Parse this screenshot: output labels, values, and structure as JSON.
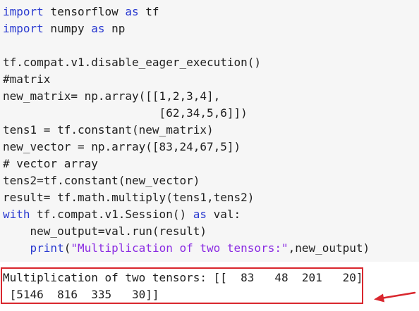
{
  "code_cell": {
    "lines": [
      [
        {
          "t": "import",
          "k": "kw"
        },
        {
          "t": " tensorflow "
        },
        {
          "t": "as",
          "k": "kw"
        },
        {
          "t": " tf"
        }
      ],
      [
        {
          "t": "import",
          "k": "kw"
        },
        {
          "t": " numpy "
        },
        {
          "t": "as",
          "k": "kw"
        },
        {
          "t": " np"
        }
      ],
      [],
      [
        {
          "t": "tf.compat.v1.disable_eager_execution()"
        }
      ],
      [
        {
          "t": "#matrix"
        }
      ],
      [
        {
          "t": "new_matrix= np.array([[1,2,3,4],"
        }
      ],
      [
        {
          "t": "                       [62,34,5,6]])"
        }
      ],
      [
        {
          "t": "tens1 = tf.constant(new_matrix)"
        }
      ],
      [
        {
          "t": "new_vector = np.array([83,24,67,5])"
        }
      ],
      [
        {
          "t": "# vector array"
        }
      ],
      [
        {
          "t": "tens2=tf.constant(new_vector)"
        }
      ],
      [
        {
          "t": "result= tf.math.multiply(tens1,tens2)"
        }
      ],
      [
        {
          "t": "with",
          "k": "kw"
        },
        {
          "t": " tf.compat.v1.Session() "
        },
        {
          "t": "as",
          "k": "kw"
        },
        {
          "t": " val:"
        }
      ],
      [
        {
          "t": "    new_output=val.run(result)"
        }
      ],
      [
        {
          "t": "    "
        },
        {
          "t": "print",
          "k": "kw"
        },
        {
          "t": "("
        },
        {
          "t": "\"Multiplication of two tensors:\"",
          "k": "str"
        },
        {
          "t": ",new_output)"
        }
      ]
    ]
  },
  "output": {
    "lines": [
      "Multiplication of two tensors: [[  83   48  201   20]",
      " [5146  816  335   30]]"
    ]
  },
  "colors": {
    "keyword": "#2a3ad0",
    "string": "#8a2be2",
    "highlight_box": "#d9272e",
    "arrow": "#d9272e",
    "code_background": "#f6f6f6"
  },
  "icons": {
    "annotation_arrow": "arrow-left-icon"
  }
}
